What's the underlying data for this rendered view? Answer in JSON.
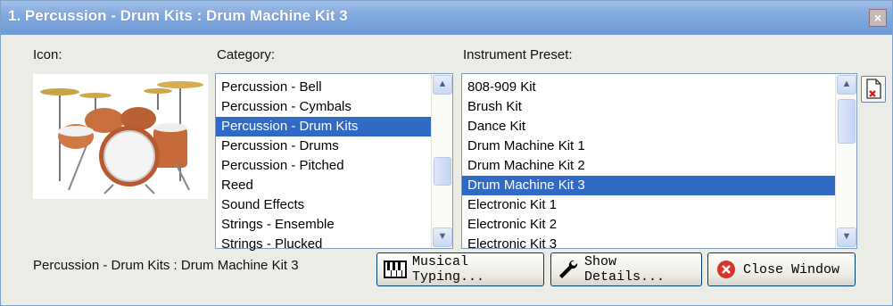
{
  "window": {
    "title": "1. Percussion - Drum Kits : Drum Machine Kit 3",
    "close_glyph": "×"
  },
  "labels": {
    "icon": "Icon:",
    "category": "Category:",
    "instrument_preset": "Instrument Preset:"
  },
  "category": {
    "items": [
      "Percussion - Bell",
      "Percussion - Cymbals",
      "Percussion - Drum Kits",
      "Percussion - Drums",
      "Percussion - Pitched",
      "Reed",
      "Sound Effects",
      "Strings - Ensemble",
      "Strings - Plucked"
    ],
    "selected": "Percussion - Drum Kits"
  },
  "preset": {
    "items": [
      "808-909 Kit",
      "Brush Kit",
      "Dance Kit",
      "Drum Machine Kit 1",
      "Drum Machine Kit 2",
      "Drum Machine Kit 3",
      "Electronic Kit 1",
      "Electronic Kit 2",
      "Electronic Kit 3"
    ],
    "selected": "Drum Machine Kit 3"
  },
  "status": "Percussion - Drum Kits : Drum Machine Kit 3",
  "buttons": {
    "musical_typing": "Musical Typing...",
    "show_details": "Show Details...",
    "close_window": "Close Window"
  },
  "icons": {
    "close": "close-icon",
    "drum_kit": "drum-kit-image",
    "delete_file": "delete-file-icon",
    "keyboard": "piano-keyboard-icon",
    "wrench": "wrench-icon",
    "close_circle": "close-circle-icon"
  },
  "colors": {
    "selection": "#316ac5",
    "titlebar": "#80a9df"
  }
}
